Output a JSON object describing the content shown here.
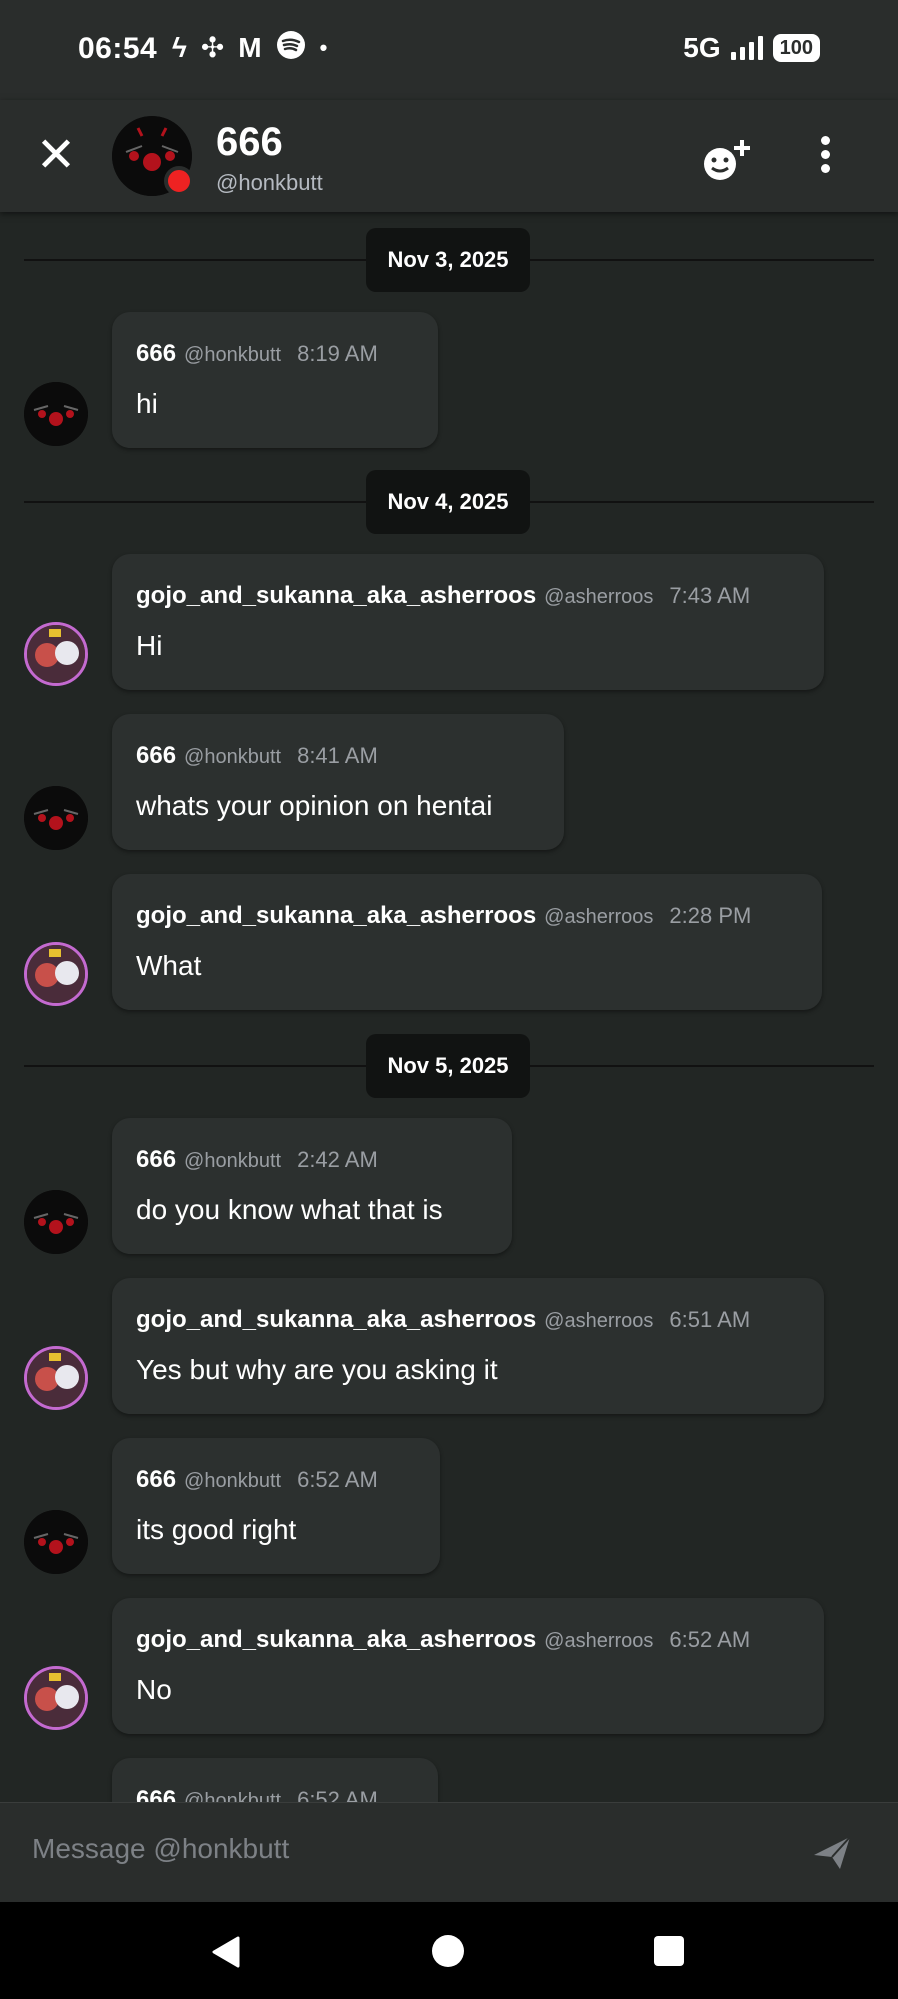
{
  "status_bar": {
    "time": "06:54",
    "network": "5G",
    "battery": "100"
  },
  "header": {
    "name": "666",
    "handle": "@honkbutt"
  },
  "dates": [
    "Nov 3, 2025",
    "Nov 4, 2025",
    "Nov 5, 2025"
  ],
  "messages": [
    {
      "name": "666",
      "handle": "@honkbutt",
      "time": "8:19 AM",
      "text": "hi"
    },
    {
      "name": "gojo_and_sukanna_aka_asherroos",
      "handle": "@asherroos",
      "time": "7:43 AM",
      "text": "Hi"
    },
    {
      "name": "666",
      "handle": "@honkbutt",
      "time": "8:41 AM",
      "text": "whats your opinion on hentai"
    },
    {
      "name": "gojo_and_sukanna_aka_asherroos",
      "handle": "@asherroos",
      "time": "2:28 PM",
      "text": "What"
    },
    {
      "name": "666",
      "handle": "@honkbutt",
      "time": "2:42 AM",
      "text": "do you know what that is"
    },
    {
      "name": "gojo_and_sukanna_aka_asherroos",
      "handle": "@asherroos",
      "time": "6:51 AM",
      "text": "Yes but why are you asking it"
    },
    {
      "name": "666",
      "handle": "@honkbutt",
      "time": "6:52 AM",
      "text": "its good right"
    },
    {
      "name": "gojo_and_sukanna_aka_asherroos",
      "handle": "@asherroos",
      "time": "6:52 AM",
      "text": "No"
    },
    {
      "name": "666",
      "handle": "@honkbutt",
      "time": "6:52 AM"
    }
  ],
  "composer": {
    "placeholder": "Message @honkbutt"
  },
  "colors": {
    "background": "#222624",
    "bubble": "#2c302f",
    "status_dot": "#e22222",
    "avatar_ring": "#c46ad0"
  },
  "icons": [
    "close-icon",
    "add-friend-icon",
    "more-icon",
    "send-icon",
    "back-icon",
    "home-icon",
    "recents-icon"
  ]
}
